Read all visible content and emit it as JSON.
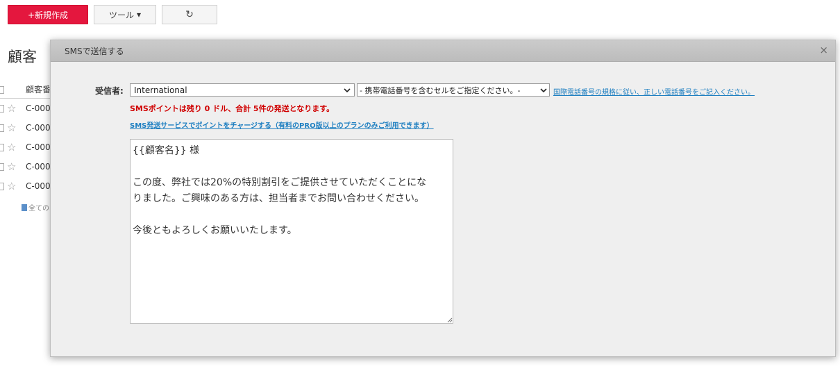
{
  "toolbar": {
    "new_label": "+新規作成",
    "tool_label": "ツール",
    "tool_caret": "▾",
    "refresh_icon": "↻"
  },
  "page": {
    "title": "顧客",
    "table_header": "顧客番",
    "rows": [
      "C-000",
      "C-000",
      "C-000",
      "C-000",
      "C-000"
    ],
    "all_link": "全ての"
  },
  "dialog": {
    "title": "SMSで送信する",
    "close_icon": "×",
    "recipient_label": "受信者:",
    "country_select": "International",
    "phone_select": "- 携帯電話番号を含むセルをご指定ください。-",
    "intl_link": "国際電話番号の規格に従い、正しい電話番号をご記入ください。",
    "warning": "SMSポイントは残り 0 ドル、合計 5件の発送となります。",
    "charge_link": "SMS発送サービスでポイントをチャージする（有料のPRO版以上のプランのみご利用できます）",
    "message": "{{顧客名}} 様\n\nこの度、弊社では20%の特別割引をご提供させていただくことにな\nりました。ご興味のある方は、担当者までお問い合わせください。\n\n今後ともよろしくお願いいたします。"
  },
  "colors": {
    "accent": "#e4173e",
    "link": "#1e7fc1",
    "warning": "#d00000"
  }
}
